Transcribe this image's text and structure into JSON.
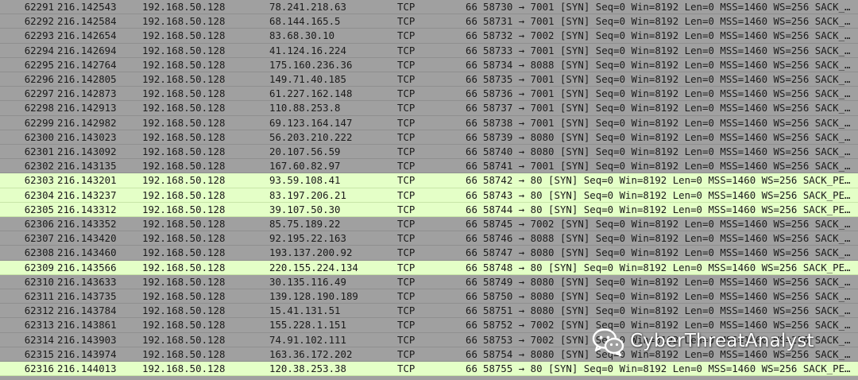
{
  "colors": {
    "row_default_bg": "#a0a0a0",
    "row_highlight_bg": "#e4ffc7",
    "text": "#1a1a1a",
    "watermark_text": "#ffffff"
  },
  "packets": [
    {
      "no": "62291",
      "time": "216.142543",
      "src": "192.168.50.128",
      "dst": "78.241.218.63",
      "proto": "TCP",
      "len": "66",
      "info": "58730 → 7001 [SYN] Seq=0 Win=8192 Len=0 MSS=1460 WS=256 SACK_…",
      "highlight": false
    },
    {
      "no": "62292",
      "time": "216.142584",
      "src": "192.168.50.128",
      "dst": "68.144.165.5",
      "proto": "TCP",
      "len": "66",
      "info": "58731 → 7001 [SYN] Seq=0 Win=8192 Len=0 MSS=1460 WS=256 SACK_…",
      "highlight": false
    },
    {
      "no": "62293",
      "time": "216.142654",
      "src": "192.168.50.128",
      "dst": "83.68.30.10",
      "proto": "TCP",
      "len": "66",
      "info": "58732 → 7002 [SYN] Seq=0 Win=8192 Len=0 MSS=1460 WS=256 SACK_…",
      "highlight": false
    },
    {
      "no": "62294",
      "time": "216.142694",
      "src": "192.168.50.128",
      "dst": "41.124.16.224",
      "proto": "TCP",
      "len": "66",
      "info": "58733 → 7001 [SYN] Seq=0 Win=8192 Len=0 MSS=1460 WS=256 SACK_…",
      "highlight": false
    },
    {
      "no": "62295",
      "time": "216.142764",
      "src": "192.168.50.128",
      "dst": "175.160.236.36",
      "proto": "TCP",
      "len": "66",
      "info": "58734 → 8088 [SYN] Seq=0 Win=8192 Len=0 MSS=1460 WS=256 SACK_…",
      "highlight": false
    },
    {
      "no": "62296",
      "time": "216.142805",
      "src": "192.168.50.128",
      "dst": "149.71.40.185",
      "proto": "TCP",
      "len": "66",
      "info": "58735 → 7001 [SYN] Seq=0 Win=8192 Len=0 MSS=1460 WS=256 SACK_…",
      "highlight": false
    },
    {
      "no": "62297",
      "time": "216.142873",
      "src": "192.168.50.128",
      "dst": "61.227.162.148",
      "proto": "TCP",
      "len": "66",
      "info": "58736 → 7001 [SYN] Seq=0 Win=8192 Len=0 MSS=1460 WS=256 SACK_…",
      "highlight": false
    },
    {
      "no": "62298",
      "time": "216.142913",
      "src": "192.168.50.128",
      "dst": "110.88.253.8",
      "proto": "TCP",
      "len": "66",
      "info": "58737 → 7001 [SYN] Seq=0 Win=8192 Len=0 MSS=1460 WS=256 SACK_…",
      "highlight": false
    },
    {
      "no": "62299",
      "time": "216.142982",
      "src": "192.168.50.128",
      "dst": "69.123.164.147",
      "proto": "TCP",
      "len": "66",
      "info": "58738 → 7001 [SYN] Seq=0 Win=8192 Len=0 MSS=1460 WS=256 SACK_…",
      "highlight": false
    },
    {
      "no": "62300",
      "time": "216.143023",
      "src": "192.168.50.128",
      "dst": "56.203.210.222",
      "proto": "TCP",
      "len": "66",
      "info": "58739 → 8080 [SYN] Seq=0 Win=8192 Len=0 MSS=1460 WS=256 SACK_…",
      "highlight": false
    },
    {
      "no": "62301",
      "time": "216.143092",
      "src": "192.168.50.128",
      "dst": "20.107.56.59",
      "proto": "TCP",
      "len": "66",
      "info": "58740 → 8080 [SYN] Seq=0 Win=8192 Len=0 MSS=1460 WS=256 SACK_…",
      "highlight": false
    },
    {
      "no": "62302",
      "time": "216.143135",
      "src": "192.168.50.128",
      "dst": "167.60.82.97",
      "proto": "TCP",
      "len": "66",
      "info": "58741 → 7001 [SYN] Seq=0 Win=8192 Len=0 MSS=1460 WS=256 SACK_…",
      "highlight": false
    },
    {
      "no": "62303",
      "time": "216.143201",
      "src": "192.168.50.128",
      "dst": "93.59.108.41",
      "proto": "TCP",
      "len": "66",
      "info": "58742 → 80 [SYN] Seq=0 Win=8192 Len=0 MSS=1460 WS=256 SACK_PE…",
      "highlight": true
    },
    {
      "no": "62304",
      "time": "216.143237",
      "src": "192.168.50.128",
      "dst": "83.197.206.21",
      "proto": "TCP",
      "len": "66",
      "info": "58743 → 80 [SYN] Seq=0 Win=8192 Len=0 MSS=1460 WS=256 SACK_PE…",
      "highlight": true
    },
    {
      "no": "62305",
      "time": "216.143312",
      "src": "192.168.50.128",
      "dst": "39.107.50.30",
      "proto": "TCP",
      "len": "66",
      "info": "58744 → 80 [SYN] Seq=0 Win=8192 Len=0 MSS=1460 WS=256 SACK_PE…",
      "highlight": true
    },
    {
      "no": "62306",
      "time": "216.143352",
      "src": "192.168.50.128",
      "dst": "85.75.189.22",
      "proto": "TCP",
      "len": "66",
      "info": "58745 → 7002 [SYN] Seq=0 Win=8192 Len=0 MSS=1460 WS=256 SACK_…",
      "highlight": false
    },
    {
      "no": "62307",
      "time": "216.143420",
      "src": "192.168.50.128",
      "dst": "92.195.22.163",
      "proto": "TCP",
      "len": "66",
      "info": "58746 → 8088 [SYN] Seq=0 Win=8192 Len=0 MSS=1460 WS=256 SACK_…",
      "highlight": false
    },
    {
      "no": "62308",
      "time": "216.143460",
      "src": "192.168.50.128",
      "dst": "193.137.200.92",
      "proto": "TCP",
      "len": "66",
      "info": "58747 → 8080 [SYN] Seq=0 Win=8192 Len=0 MSS=1460 WS=256 SACK_…",
      "highlight": false
    },
    {
      "no": "62309",
      "time": "216.143566",
      "src": "192.168.50.128",
      "dst": "220.155.224.134",
      "proto": "TCP",
      "len": "66",
      "info": "58748 → 80 [SYN] Seq=0 Win=8192 Len=0 MSS=1460 WS=256 SACK_PE…",
      "highlight": true
    },
    {
      "no": "62310",
      "time": "216.143633",
      "src": "192.168.50.128",
      "dst": "30.135.116.49",
      "proto": "TCP",
      "len": "66",
      "info": "58749 → 8080 [SYN] Seq=0 Win=8192 Len=0 MSS=1460 WS=256 SACK_…",
      "highlight": false
    },
    {
      "no": "62311",
      "time": "216.143735",
      "src": "192.168.50.128",
      "dst": "139.128.190.189",
      "proto": "TCP",
      "len": "66",
      "info": "58750 → 8080 [SYN] Seq=0 Win=8192 Len=0 MSS=1460 WS=256 SACK_…",
      "highlight": false
    },
    {
      "no": "62312",
      "time": "216.143784",
      "src": "192.168.50.128",
      "dst": "15.41.131.51",
      "proto": "TCP",
      "len": "66",
      "info": "58751 → 8080 [SYN] Seq=0 Win=8192 Len=0 MSS=1460 WS=256 SACK_…",
      "highlight": false
    },
    {
      "no": "62313",
      "time": "216.143861",
      "src": "192.168.50.128",
      "dst": "155.228.1.151",
      "proto": "TCP",
      "len": "66",
      "info": "58752 → 7002 [SYN] Seq=0 Win=8192 Len=0 MSS=1460 WS=256 SACK_…",
      "highlight": false
    },
    {
      "no": "62314",
      "time": "216.143903",
      "src": "192.168.50.128",
      "dst": "74.91.102.111",
      "proto": "TCP",
      "len": "66",
      "info": "58753 → 7002 [SYN] Seq=0 Win=8192 Len=0 MSS=1460 WS=256 SACK_…",
      "highlight": false
    },
    {
      "no": "62315",
      "time": "216.143974",
      "src": "192.168.50.128",
      "dst": "163.36.172.202",
      "proto": "TCP",
      "len": "66",
      "info": "58754 → 8080 [SYN] Seq=0 Win=8192 Len=0 MSS=1460 WS=256 SACK_…",
      "highlight": false
    },
    {
      "no": "62316",
      "time": "216.144013",
      "src": "192.168.50.128",
      "dst": "120.38.253.38",
      "proto": "TCP",
      "len": "66",
      "info": "58755 → 80 [SYN] Seq=0 Win=8192 Len=0 MSS=1460 WS=256 SACK_PE…",
      "highlight": true
    }
  ],
  "watermark": {
    "icon": "wechat-icon",
    "text": "CyberThreatAnalyst"
  }
}
